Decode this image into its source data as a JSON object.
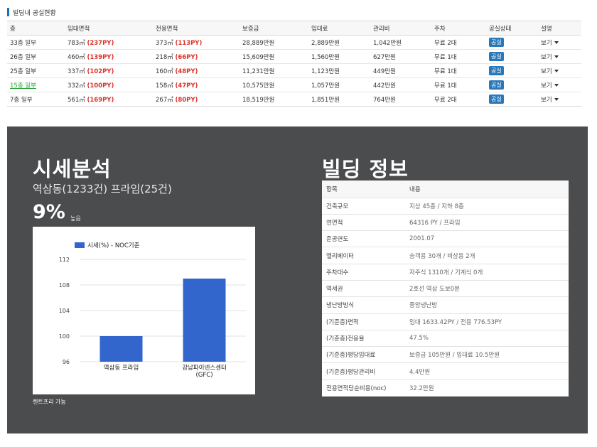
{
  "vacancy": {
    "title": "빌딩내 공실현황",
    "headers": [
      "층",
      "임대면적",
      "전용면적",
      "보증금",
      "임대료",
      "관리비",
      "주차",
      "공실상태",
      "설명"
    ],
    "rows": [
      {
        "floor": "33층 일부",
        "lease_area": "783㎡",
        "lease_py": "(237PY)",
        "exclusive_area": "373㎡",
        "exclusive_py": "(113PY)",
        "deposit": "28,889만원",
        "rent": "2,889만원",
        "mgmt": "1,042만원",
        "parking": "무료 2대",
        "status": "공실",
        "desc": "보기"
      },
      {
        "floor": "26층 일부",
        "lease_area": "460㎡",
        "lease_py": "(139PY)",
        "exclusive_area": "218㎡",
        "exclusive_py": "(66PY)",
        "deposit": "15,609만원",
        "rent": "1,560만원",
        "mgmt": "627만원",
        "parking": "무료 1대",
        "status": "공실",
        "desc": "보기"
      },
      {
        "floor": "25층 일부",
        "lease_area": "337㎡",
        "lease_py": "(102PY)",
        "exclusive_area": "160㎡",
        "exclusive_py": "(48PY)",
        "deposit": "11,231만원",
        "rent": "1,123만원",
        "mgmt": "449만원",
        "parking": "무료 1대",
        "status": "공실",
        "desc": "보기"
      },
      {
        "floor": "15층 일부",
        "lease_area": "332㎡",
        "lease_py": "(100PY)",
        "exclusive_area": "158㎡",
        "exclusive_py": "(47PY)",
        "deposit": "10,575만원",
        "rent": "1,057만원",
        "mgmt": "442만원",
        "parking": "무료 1대",
        "status": "공실",
        "desc": "보기"
      },
      {
        "floor": "7층 일부",
        "lease_area": "561㎡",
        "lease_py": "(169PY)",
        "exclusive_area": "267㎡",
        "exclusive_py": "(80PY)",
        "deposit": "18,519만원",
        "rent": "1,851만원",
        "mgmt": "764만원",
        "parking": "무료 2대",
        "status": "공실",
        "desc": "보기"
      }
    ]
  },
  "market": {
    "title": "시세분석",
    "subtitle": "역삼동(1233건) 프라임(25건)",
    "percent": "9%",
    "percent_note": "높음",
    "footnote": "렌트프리 가능"
  },
  "chart_data": {
    "type": "bar",
    "categories": [
      "역삼동 프라임",
      "강남파이넨스센터\n(GFC)"
    ],
    "series": [
      {
        "name": "시세(%) - NOC기준",
        "values": [
          100,
          109
        ]
      }
    ],
    "ylim": [
      96,
      112
    ],
    "yticks": [
      96,
      100,
      104,
      108,
      112
    ],
    "grid": true,
    "legend": "top-left",
    "color": "#3366cc"
  },
  "building": {
    "title": "빌딩 정보",
    "headers": [
      "항목",
      "내용"
    ],
    "rows": [
      {
        "item": "건축규모",
        "value": "지상 45층 / 지하 8층"
      },
      {
        "item": "연면적",
        "value": "64316 PY / 프라임"
      },
      {
        "item": "준공연도",
        "value": "2001.07"
      },
      {
        "item": "엘리베이터",
        "value": "승객용 30개 / 비상용 2개"
      },
      {
        "item": "주차대수",
        "value": "자주식 1310개 / 기계식 0개"
      },
      {
        "item": "역세권",
        "value": "2호선 역삼 도보0분"
      },
      {
        "item": "냉난방방식",
        "value": "중앙냉난방"
      },
      {
        "item": "(기준층)면적",
        "value": "임대 1633.42PY / 전용 776.53PY"
      },
      {
        "item": "(기준층)전용율",
        "value": "47.5%"
      },
      {
        "item": "(기준층)평당임대료",
        "value": "보증금 105만원 / 임대료 10.5만원"
      },
      {
        "item": "(기준층)평당관리비",
        "value": "4.4만원"
      },
      {
        "item": "전용면적당순비용(noc)",
        "value": "32.2만원"
      }
    ]
  }
}
